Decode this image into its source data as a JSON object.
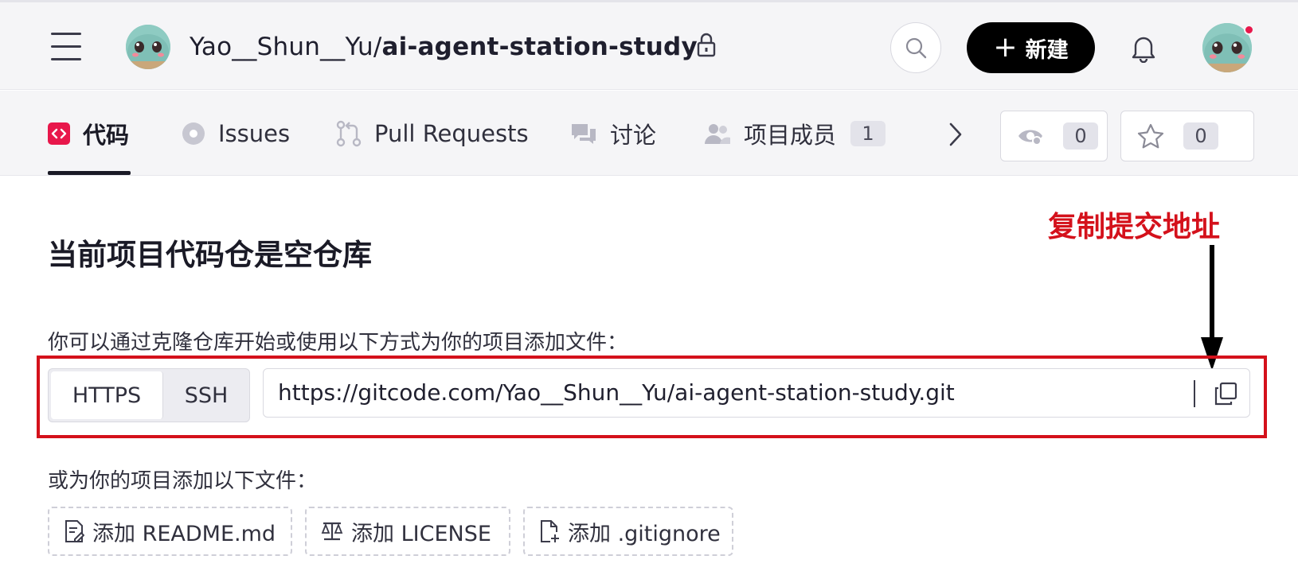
{
  "header": {
    "repo_owner": "Yao__Shun__Yu",
    "repo_separator": "/",
    "repo_name": "ai-agent-station-study",
    "new_button_label": "新建",
    "new_button_icon": "plus-icon",
    "icons": [
      "hamburger-menu-icon",
      "repo-avatar",
      "lock-icon",
      "search-icon",
      "bell-icon",
      "user-avatar"
    ],
    "notification_dot_color": "#e8174b"
  },
  "tabs": [
    {
      "label": "代码",
      "icon": "code-icon",
      "active": true
    },
    {
      "label": "Issues",
      "icon": "issues-icon"
    },
    {
      "label": "Pull Requests",
      "icon": "pull-request-icon"
    },
    {
      "label": "讨论",
      "icon": "discussion-icon"
    },
    {
      "label": "项目成员",
      "icon": "members-icon",
      "count": "1"
    }
  ],
  "stats": {
    "watch_count": "0",
    "star_count": "0"
  },
  "main": {
    "heading": "当前项目代码仓是空仓库",
    "instruction": "你可以通过克隆仓库开始或使用以下方式为你的项目添加文件：",
    "protocols": [
      "HTTPS",
      "SSH"
    ],
    "selected_protocol": "HTTPS",
    "clone_url": "https://gitcode.com/Yao__Shun__Yu/ai-agent-station-study.git",
    "or_text": "或为你的项目添加以下文件：",
    "add_files": [
      {
        "label": "添加 README.md",
        "icon": "readme-file-icon"
      },
      {
        "label": "添加 LICENSE",
        "icon": "license-scale-icon"
      },
      {
        "label": "添加 .gitignore",
        "icon": "add-file-icon"
      }
    ]
  },
  "annotation": {
    "label": "复制提交地址",
    "color": "#d4111b"
  },
  "colors": {
    "accent_code": "#e8174b",
    "primary_button": "#000000",
    "annotation_red": "#d4111b"
  }
}
